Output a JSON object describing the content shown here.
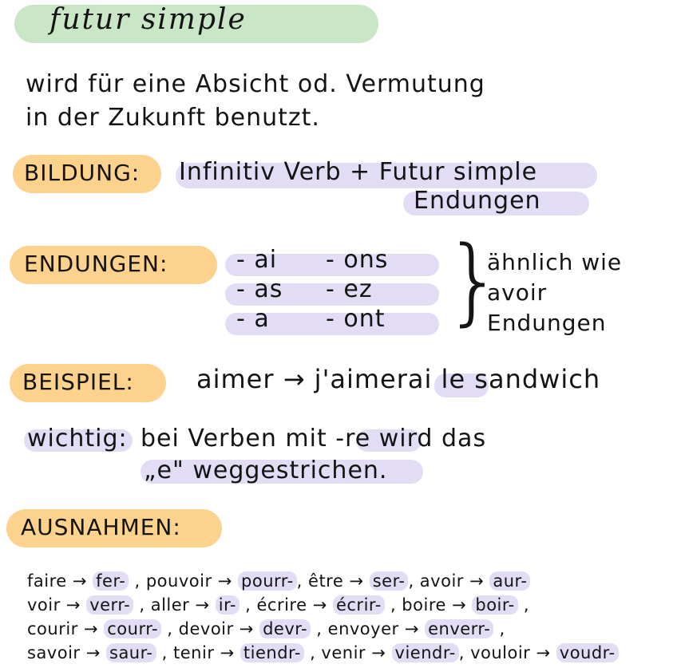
{
  "title": "futur simple",
  "intro": {
    "line1": "wird für eine Absicht od. Vermutung",
    "line2": "in der Zukunft benutzt."
  },
  "bildung": {
    "label": "BILDUNG:",
    "line1": "Infinitiv Verb + Futur simple",
    "line2": "Endungen"
  },
  "endungen": {
    "label": "ENDUNGEN:",
    "rows": [
      {
        "left": "- ai",
        "right": "- ons"
      },
      {
        "left": "- as",
        "right": "- ez"
      },
      {
        "left": "- a",
        "right": "- ont"
      }
    ],
    "note_line1": "ähnlich wie",
    "note_line2": "avoir",
    "note_line3": "Endungen"
  },
  "beispiel": {
    "label": "BEISPIEL:",
    "text": "aimer → j'aimerai le sandwich"
  },
  "wichtig": {
    "label": "wichtig:",
    "line1": "bei Verben mit -re wird das",
    "line2": "„e\" weggestrichen."
  },
  "ausnahmen": {
    "label": "AUSNAHMEN:",
    "lines": [
      [
        {
          "t": "faire → "
        },
        {
          "t": "fer-",
          "hl": true
        },
        {
          "t": " , pouvoir → "
        },
        {
          "t": "pourr-",
          "hl": true
        },
        {
          "t": ", être → "
        },
        {
          "t": "ser-",
          "hl": true
        },
        {
          "t": ", avoir → "
        },
        {
          "t": "aur-",
          "hl": true
        }
      ],
      [
        {
          "t": "voir → "
        },
        {
          "t": "verr-",
          "hl": true
        },
        {
          "t": " , aller → "
        },
        {
          "t": "ir-",
          "hl": true
        },
        {
          "t": " , écrire → "
        },
        {
          "t": "écrir-",
          "hl": true
        },
        {
          "t": " , boire → "
        },
        {
          "t": "boir-",
          "hl": true
        },
        {
          "t": " ,"
        }
      ],
      [
        {
          "t": "courir → "
        },
        {
          "t": "courr-",
          "hl": true
        },
        {
          "t": " , devoir → "
        },
        {
          "t": "devr-",
          "hl": true
        },
        {
          "t": " , envoyer → "
        },
        {
          "t": "enverr-",
          "hl": true
        },
        {
          "t": " ,"
        }
      ],
      [
        {
          "t": "savoir → "
        },
        {
          "t": "saur-",
          "hl": true
        },
        {
          "t": " , tenir → "
        },
        {
          "t": "tiendr-",
          "hl": true
        },
        {
          "t": " , venir → "
        },
        {
          "t": "viendr-",
          "hl": true
        },
        {
          "t": ", vouloir → "
        },
        {
          "t": "voudr-",
          "hl": true
        }
      ]
    ]
  },
  "colors": {
    "title_highlight": "#c9e6c6",
    "label_highlight": "#fcd28d",
    "term_highlight": "#e3dcf5",
    "ink": "#141414"
  }
}
